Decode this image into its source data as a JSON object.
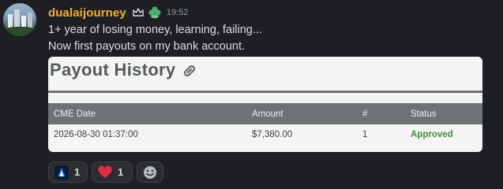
{
  "message": {
    "username": "dualaijourney",
    "timestamp": "19:52",
    "badges": [
      "crown-icon",
      "clover-icon"
    ],
    "lines": [
      "1+ year of losing money, learning, failing...",
      "Now first payouts on my bank account."
    ]
  },
  "card": {
    "title": "Payout History",
    "columns": [
      "CME Date",
      "Amount",
      "#",
      "Status"
    ],
    "rows": [
      {
        "date": "2026-08-30 01:37:00",
        "amount": "$7,380.00",
        "number": "1",
        "status": "Approved"
      }
    ],
    "status_color": "#3f8f3a"
  },
  "reactions": [
    {
      "emoji": "custom-logo-emoji",
      "count": "1"
    },
    {
      "emoji": "heart-emoji",
      "count": "1"
    },
    {
      "emoji": "add-reaction-icon",
      "count": ""
    }
  ],
  "colors": {
    "background": "#1e1f22",
    "username": "#f0b232"
  }
}
